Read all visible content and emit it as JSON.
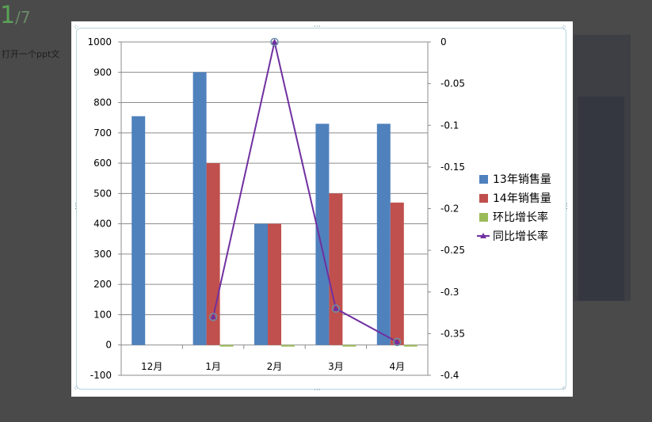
{
  "background": {
    "page_current": "1",
    "page_total": "/7",
    "text": "打开一个ppt文"
  },
  "chart_data": {
    "type": "bar",
    "categories": [
      "12月",
      "1月",
      "2月",
      "3月",
      "4月"
    ],
    "series": [
      {
        "name": "13年销售量",
        "kind": "bar",
        "axis": "left",
        "color": "#4f81bd",
        "values": [
          755,
          900,
          400,
          730,
          730
        ]
      },
      {
        "name": "14年销售量",
        "kind": "bar",
        "axis": "left",
        "color": "#c0504d",
        "values": [
          null,
          600,
          400,
          500,
          470
        ]
      },
      {
        "name": "环比增长率",
        "kind": "bar",
        "axis": "left",
        "color": "#9bbb59",
        "values": [
          null,
          -2,
          -2,
          -2,
          -2
        ]
      },
      {
        "name": "同比增长率",
        "kind": "line",
        "axis": "right",
        "color": "#7030a0",
        "values": [
          null,
          -0.33,
          0,
          -0.32,
          -0.36
        ]
      }
    ],
    "ylim": [
      -100,
      1000
    ],
    "yticks": [
      "1000",
      "900",
      "800",
      "700",
      "600",
      "500",
      "400",
      "300",
      "200",
      "100",
      "0",
      "-100"
    ],
    "y2lim": [
      -0.4,
      0
    ],
    "y2ticks": [
      "0",
      "-0.05",
      "-0.1",
      "-0.15",
      "-0.2",
      "-0.25",
      "-0.3",
      "-0.35",
      "-0.4"
    ],
    "grid": true,
    "legend": "right",
    "title": "",
    "xlabel": "",
    "ylabel": ""
  }
}
